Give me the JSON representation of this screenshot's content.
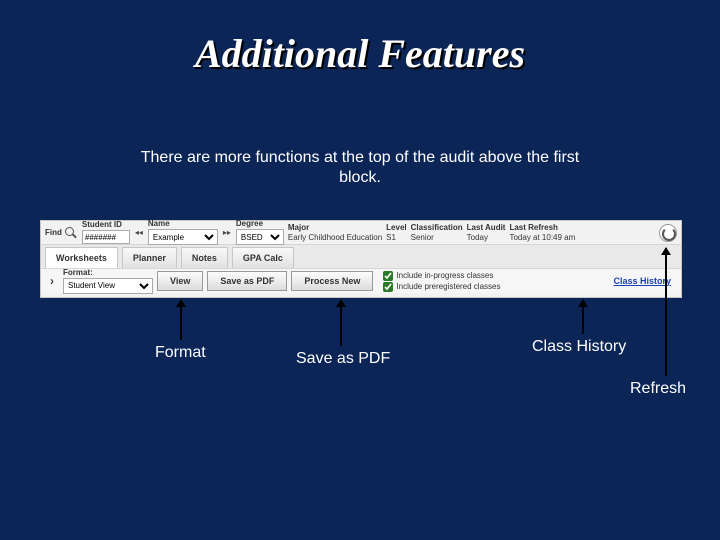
{
  "slide": {
    "title": "Additional Features",
    "subtitle": "There are more functions at the top of the audit above the first block."
  },
  "audit": {
    "find_label": "Find",
    "student_id_label": "Student ID",
    "student_id_value": "#######",
    "name_label": "Name",
    "name_value": "Example",
    "degree_label": "Degree",
    "degree_value": "BSED",
    "major_label": "Major",
    "major_value": "Early Childhood Education",
    "level_label": "Level",
    "level_value": "S1",
    "classification_label": "Classification",
    "classification_value": "Senior",
    "last_audit_label": "Last Audit",
    "last_audit_value": "Today",
    "last_refresh_label": "Last Refresh",
    "last_refresh_value": "Today at 10:49 am"
  },
  "tabs": {
    "worksheets": "Worksheets",
    "planner": "Planner",
    "notes": "Notes",
    "gpa_calc": "GPA Calc"
  },
  "actions": {
    "format_label": "Format:",
    "format_value": "Student View",
    "view": "View",
    "save_pdf": "Save as PDF",
    "process_new": "Process New",
    "include_inprogress": "Include in-progress classes",
    "include_prereg": "Include preregistered classes",
    "class_history": "Class History"
  },
  "annotations": {
    "format": "Format",
    "save_pdf": "Save as PDF",
    "class_history": "Class History",
    "refresh": "Refresh"
  }
}
